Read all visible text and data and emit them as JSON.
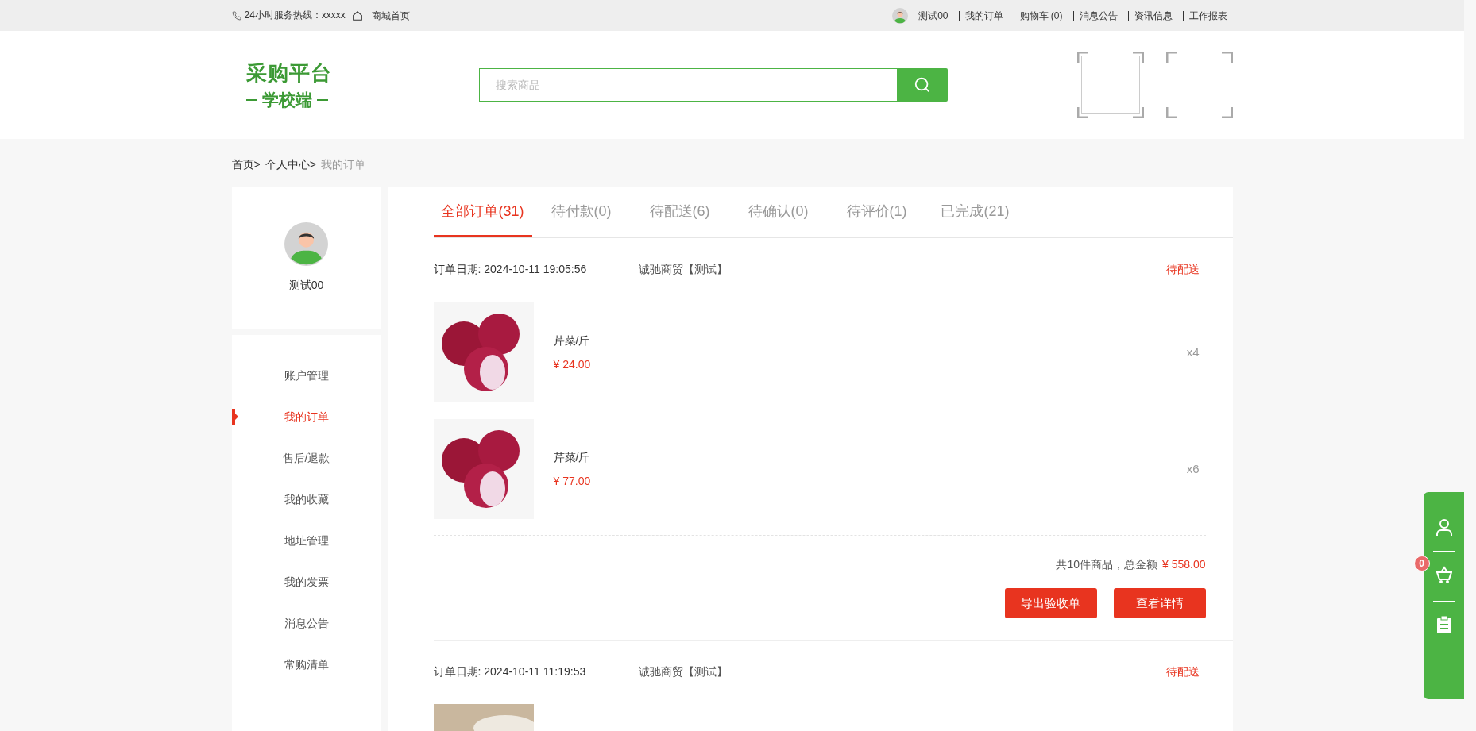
{
  "top_bar": {
    "hotline": "24小时服务热线：xxxxx",
    "home_link": "商城首页",
    "user": "测试00",
    "links": [
      "我的订单",
      "购物车 (0)",
      "消息公告",
      "资讯信息",
      "工作报表"
    ]
  },
  "header": {
    "logo_title": "采购平台",
    "logo_subtitle": "学校端",
    "search": {
      "placeholder": "搜索商品"
    }
  },
  "breadcrumb": [
    {
      "label": "首页>",
      "current": false
    },
    {
      "label": "个人中心>",
      "current": false
    },
    {
      "label": "我的订单",
      "current": true
    }
  ],
  "profile": {
    "name": "测试00"
  },
  "menu": [
    {
      "label": "账户管理",
      "selected": false
    },
    {
      "label": "我的订单",
      "selected": true
    },
    {
      "label": "售后/退款",
      "selected": false
    },
    {
      "label": "我的收藏",
      "selected": false
    },
    {
      "label": "地址管理",
      "selected": false
    },
    {
      "label": "我的发票",
      "selected": false
    },
    {
      "label": "消息公告",
      "selected": false
    },
    {
      "label": "常购清单",
      "selected": false
    }
  ],
  "tabs": [
    {
      "label": "全部订单(31)",
      "selected": true
    },
    {
      "label": "待付款(0)",
      "selected": false
    },
    {
      "label": "待配送(6)",
      "selected": false
    },
    {
      "label": "待确认(0)",
      "selected": false
    },
    {
      "label": "待评价(1)",
      "selected": false
    },
    {
      "label": "已完成(21)",
      "selected": false
    }
  ],
  "orders": [
    {
      "date": "订单日期: 2024-10-11 19:05:56",
      "shop": "诚驰商贸【测试】",
      "status": "待配送",
      "items": [
        {
          "kind": "product",
          "name": "芹菜/斤",
          "price": "¥ 24.00",
          "quantity": "x4"
        },
        {
          "kind": "product",
          "name": "芹菜/斤",
          "price": "¥ 77.00",
          "quantity": "x6"
        }
      ],
      "summary": "共10件商品，总金额",
      "total": "¥ 558.00",
      "actions": [
        "导出验收单",
        "查看详情"
      ]
    },
    {
      "date": "订单日期: 2024-10-11 11:19:53",
      "shop": "诚驰商贸【测试】",
      "status": "待配送",
      "items": [
        {
          "kind": "photo_only"
        }
      ]
    }
  ],
  "side_panel": {
    "cart_count": "0"
  }
}
